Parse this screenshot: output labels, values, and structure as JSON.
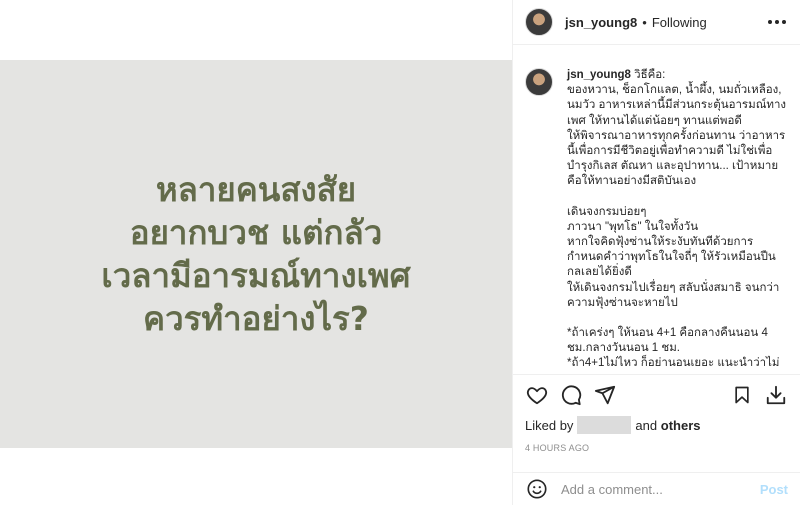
{
  "post": {
    "image_text": "หลายคนสงสัย\nอยากบวช แต่กลัว\nเวลามีอารมณ์ทางเพศ\nควรทำอย่างไร?"
  },
  "header": {
    "username": "jsn_young8",
    "separator": "•",
    "follow_status": "Following"
  },
  "caption": {
    "username": "jsn_young8",
    "lines": [
      "วิธีคือ:",
      "ของหวาน, ช็อกโกแลต, น้ำผึ้ง, นมถั่วเหลือง,",
      "นมวัว อาหารเหล่านี้มีส่วนกระตุ้นอารมณ์ทาง",
      "เพศ ให้ทานได้แต่น้อยๆ ทานแต่พอดี",
      "ให้พิจารณาอาหารทุกครั้งก่อนทาน ว่าอาหาร",
      "นี้เพื่อการมีชีวิตอยู่เพื่อทำความดี ไม่ใช่เพื่อ",
      "บำรุงกิเลส ตัณหา และอุปาทาน... เป้าหมาย",
      "คือให้ทานอย่างมีสติบันเอง",
      "",
      "เดินจงกรมบ่อยๆ",
      "ภาวนา \"พุทโธ\" ในใจทั้งวัน",
      "หากใจคิดฟุ้งซ่านให้ระงับทันทีด้วยการ",
      "กำหนดคำว่าพุทโธในใจถี่ๆ ให้รัวเหมือนปืน",
      "กลเลยได้ยิ่งดี",
      "ให้เดินจงกรมไปเรื่อยๆ สลับนั่งสมาธิ จนกว่า",
      "ความฟุ้งซ่านจะหายไป",
      "",
      "*ถ้าเคร่งๆ ให้นอน 4+1 คือกลางคืนนอน 4",
      "ชม.กลางวันนอน 1 ชม.",
      "*ถ้า4+1ไม่ไหว ก็อย่านอนเยอะ แนะนำว่าไม่"
    ]
  },
  "actions": {
    "icons": [
      "heart-icon",
      "comment-icon",
      "share-icon",
      "bookmark-icon",
      "download-icon"
    ]
  },
  "likes": {
    "prefix": "Liked by",
    "connector": "and",
    "suffix": "others"
  },
  "timestamp": "4 HOURS AGO",
  "comment_box": {
    "placeholder": "Add a comment...",
    "post_label": "Post"
  },
  "colors": {
    "image_bg": "#e4e4e2",
    "image_text": "#636b4a",
    "post_button": "#b2dffc",
    "muted": "#8e8e8e"
  }
}
